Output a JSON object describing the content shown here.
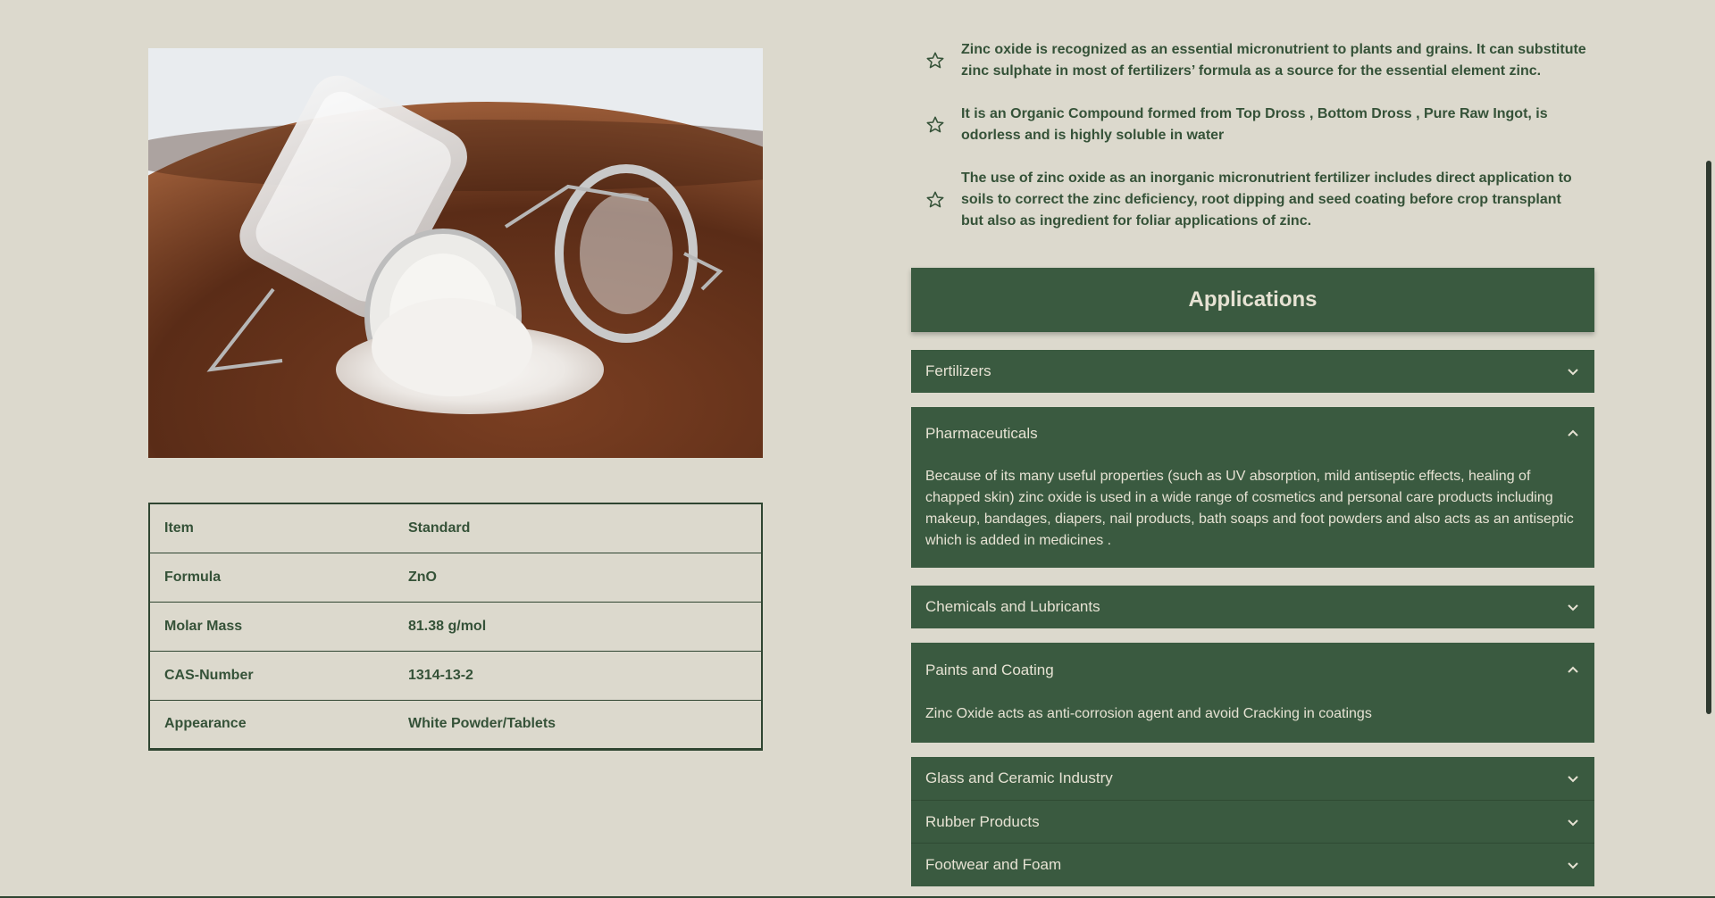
{
  "image": {
    "alt": "Glass jar spilling white zinc oxide powder on wooden plate"
  },
  "spec_table": {
    "rows": [
      {
        "key": "Item",
        "value": "Standard"
      },
      {
        "key": "Formula",
        "value": "ZnO"
      },
      {
        "key": "Molar Mass",
        "value": "81.38 g/mol"
      },
      {
        "key": "CAS-Number",
        "value": "1314-13-2"
      },
      {
        "key": "Appearance",
        "value": "White Powder/Tablets"
      }
    ]
  },
  "features": [
    {
      "icon": "star-icon",
      "text": "Zinc oxide is recognized as an essential micronutrient to plants and grains. It can substitute zinc sulphate in most of fertilizers’ formula as a source for the essential element zinc."
    },
    {
      "icon": "star-icon",
      "text": "It is an Organic Compound formed from Top Dross , Bottom Dross , Pure Raw Ingot, is odorless and is highly soluble in water"
    },
    {
      "icon": "star-icon",
      "text": "The use of zinc oxide as an inorganic micronutrient fertilizer includes direct application to soils to correct the zinc deficiency, root dipping and seed coating before crop transplant but also as ingredient for foliar applications of zinc."
    }
  ],
  "applications": {
    "title": "Applications",
    "items": [
      {
        "label": "Fertilizers",
        "expanded": false,
        "body": ""
      },
      {
        "label": "Pharmaceuticals",
        "expanded": true,
        "body": "Because of its many useful properties (such as UV absorption, mild antiseptic effects, healing of chapped skin) zinc oxide is used in a wide range of cosmetics and personal care products including makeup, bandages, diapers, nail products, bath soaps and foot powders and also acts as an antiseptic which is added in medicines ."
      },
      {
        "label": "Chemicals and Lubricants",
        "expanded": false,
        "body": ""
      },
      {
        "label": "Paints and Coating",
        "expanded": true,
        "body": "Zinc Oxide acts as anti-corrosion agent and avoid Cracking in coatings"
      },
      {
        "label": "Glass and Ceramic Industry",
        "expanded": false,
        "body": ""
      },
      {
        "label": "Rubber Products",
        "expanded": false,
        "body": ""
      },
      {
        "label": "Footwear and Foam",
        "expanded": false,
        "body": ""
      }
    ]
  },
  "colors": {
    "background": "#dcd9cd",
    "accent_green": "#3a5a40",
    "text_green": "#355238",
    "light_text": "#e6e2d3"
  }
}
